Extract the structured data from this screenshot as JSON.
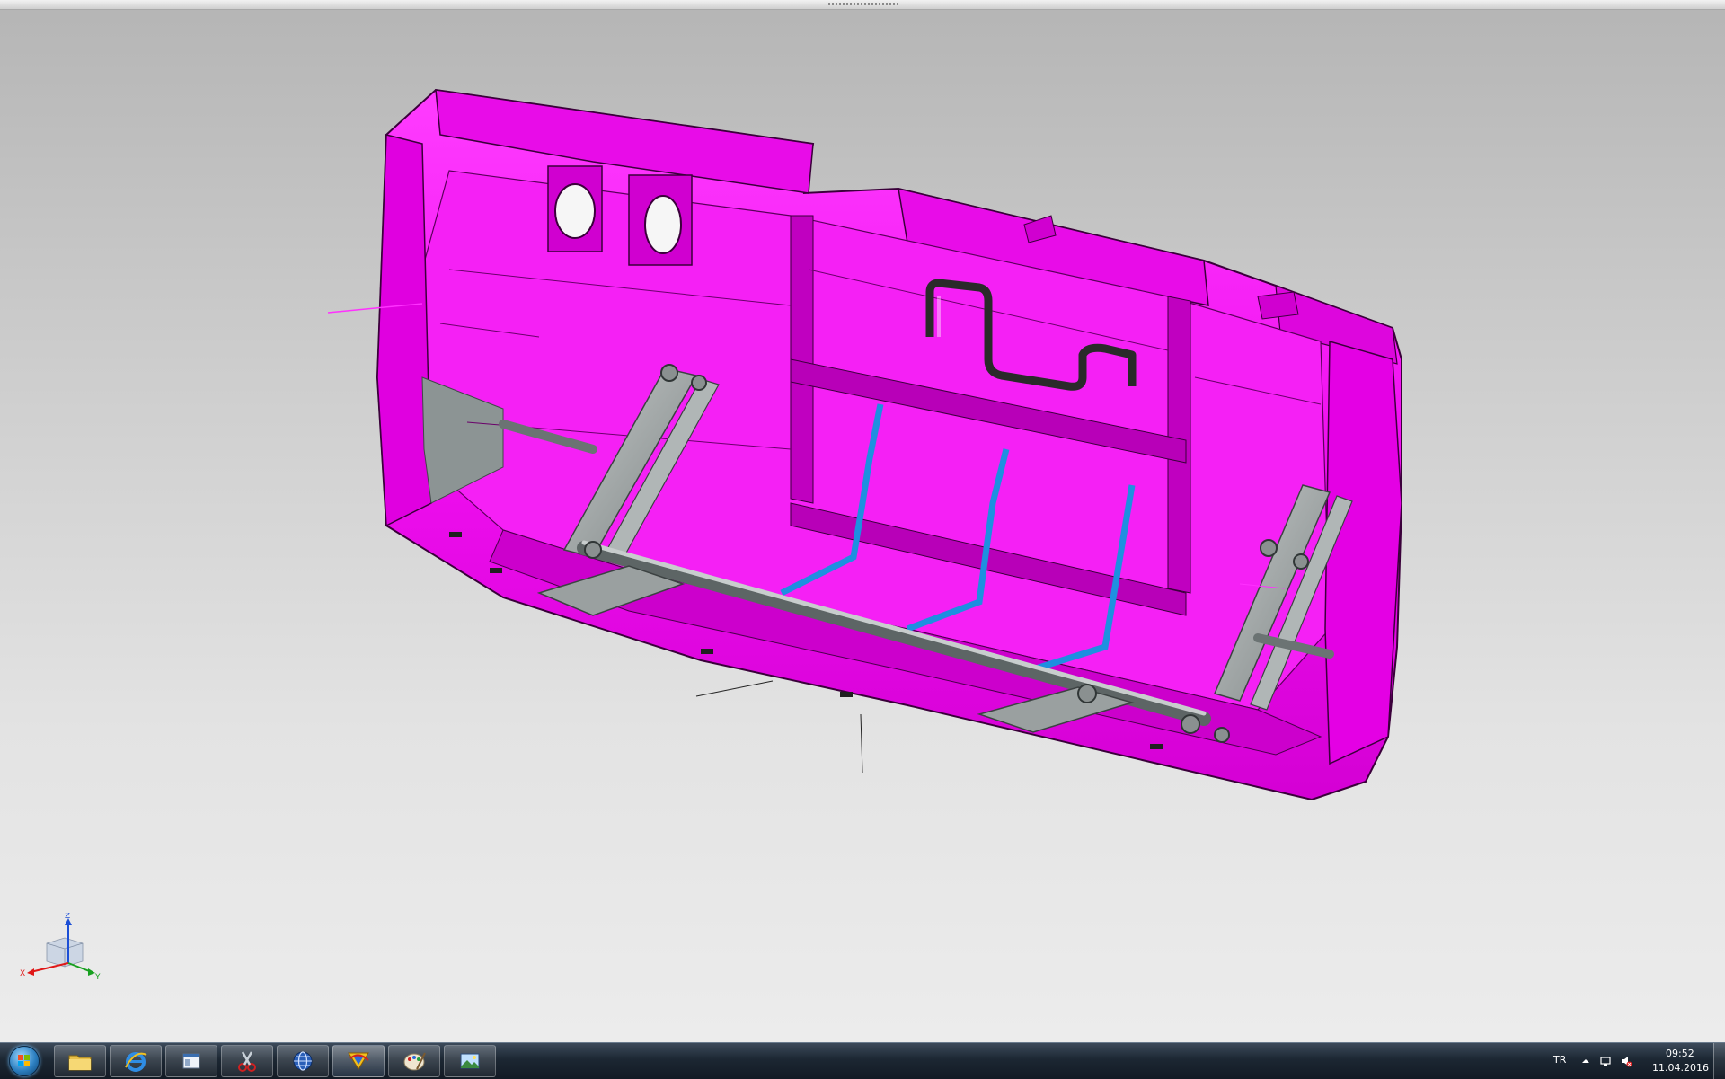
{
  "viewport": {
    "triad": {
      "x_label": "X",
      "y_label": "Y",
      "z_label": "Z"
    },
    "colors": {
      "part_fill": "#f00ff0",
      "part_dark": "#a800a8",
      "part_edge": "#3a003a",
      "mechanism_grey": "#9aa0a0",
      "hose_blue": "#1e8fe0",
      "background_top": "#b5b5b5",
      "background_bottom": "#ececec"
    }
  },
  "taskbar": {
    "apps": [
      {
        "name": "windows-explorer",
        "icon": "folder-icon"
      },
      {
        "name": "internet-explorer",
        "icon": "ie-icon"
      },
      {
        "name": "window-app",
        "icon": "window-icon"
      },
      {
        "name": "snipping-tool",
        "icon": "scissors-icon"
      },
      {
        "name": "browser",
        "icon": "globe-icon"
      },
      {
        "name": "catia",
        "icon": "catia-icon"
      },
      {
        "name": "paint",
        "icon": "palette-icon"
      },
      {
        "name": "picture-viewer",
        "icon": "picture-icon"
      }
    ],
    "language": "TR",
    "time": "09:52",
    "date": "11.04.2016"
  }
}
